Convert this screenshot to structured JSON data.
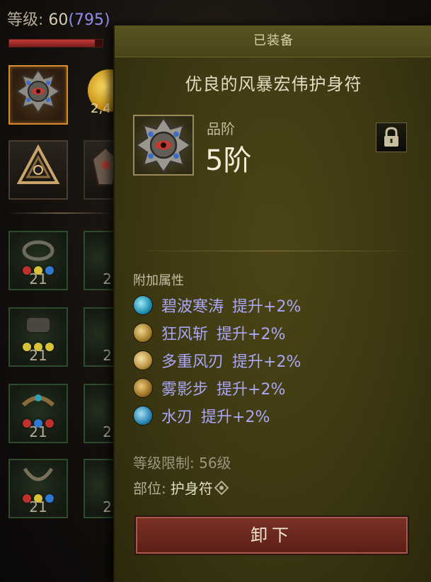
{
  "header": {
    "level_label": "等级:",
    "level_value": "60",
    "level_paragon": "(795)"
  },
  "inventory": {
    "currency_amount": "2,4",
    "green_slots": [
      {
        "count": "21",
        "gems": [
          "r",
          "y",
          "b"
        ]
      },
      {
        "count": "2"
      },
      {
        "count": "21",
        "gems": [
          "y",
          "y",
          "y"
        ]
      },
      {
        "count": "2"
      },
      {
        "count": "21",
        "gems": [
          "r",
          "b",
          "r"
        ]
      },
      {
        "count": "2"
      },
      {
        "count": "21",
        "gems": [
          "r",
          "y",
          "b"
        ]
      },
      {
        "count": "2"
      }
    ]
  },
  "tooltip": {
    "status": "已装备",
    "item_name": "优良的风暴宏伟护身符",
    "grade_label": "品阶",
    "grade_value": "5阶",
    "affix_title": "附加属性",
    "affixes": [
      {
        "skill": "碧波寒涛",
        "effect": "提升+2%",
        "icon": "water-wave-icon",
        "color": "#34b6d6"
      },
      {
        "skill": "狂风斩",
        "effect": "提升+2%",
        "icon": "gale-slash-icon",
        "color": "#c8a24a"
      },
      {
        "skill": "多重风刃",
        "effect": "提升+2%",
        "icon": "multi-wind-blade-icon",
        "color": "#d8b45a"
      },
      {
        "skill": "雾影步",
        "effect": "提升+2%",
        "icon": "mist-step-icon",
        "color": "#c49a3c"
      },
      {
        "skill": "水刃",
        "effect": "提升+2%",
        "icon": "water-blade-icon",
        "color": "#3fa6cf"
      }
    ],
    "level_requirement": "等级限制: 56级",
    "slot_label": "部位:",
    "slot_value": "护身符",
    "unequip_label": "卸下"
  }
}
